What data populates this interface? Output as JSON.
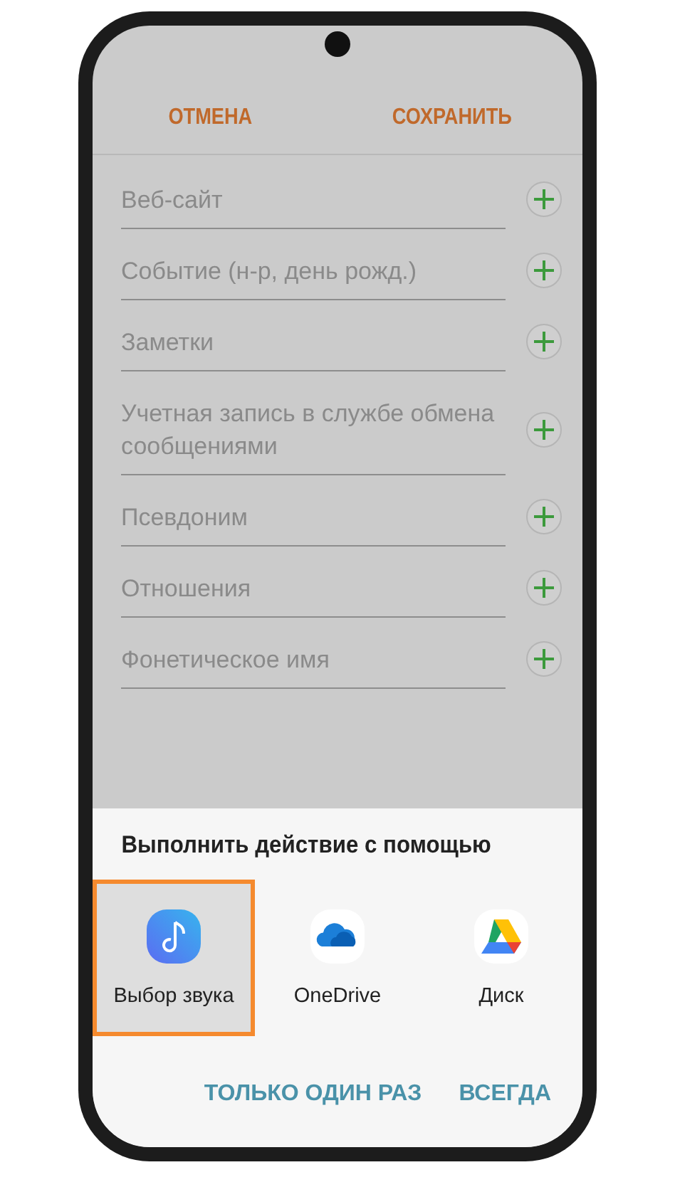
{
  "top_bar": {
    "buttons": [
      "ОТМЕНА",
      "СОХРАНИТЬ"
    ]
  },
  "fields": [
    {
      "label": "Веб-сайт"
    },
    {
      "label": "Событие (н-р, день рожд.)"
    },
    {
      "label": "Заметки"
    },
    {
      "label": "Учетная запись в службе обмена сообщениями"
    },
    {
      "label": "Псевдоним"
    },
    {
      "label": "Отношения"
    },
    {
      "label": "Фонетическое имя"
    }
  ],
  "sheet": {
    "title": "Выполнить действие с помощью",
    "apps": [
      {
        "kind": "sound",
        "label": "Выбор звука",
        "selected": true
      },
      {
        "kind": "onedrive",
        "label": "OneDrive",
        "selected": false
      },
      {
        "kind": "drive",
        "label": "Диск",
        "selected": false
      }
    ],
    "buttons": [
      "ТОЛЬКО ОДИН РАЗ",
      "ВСЕГДА"
    ]
  }
}
